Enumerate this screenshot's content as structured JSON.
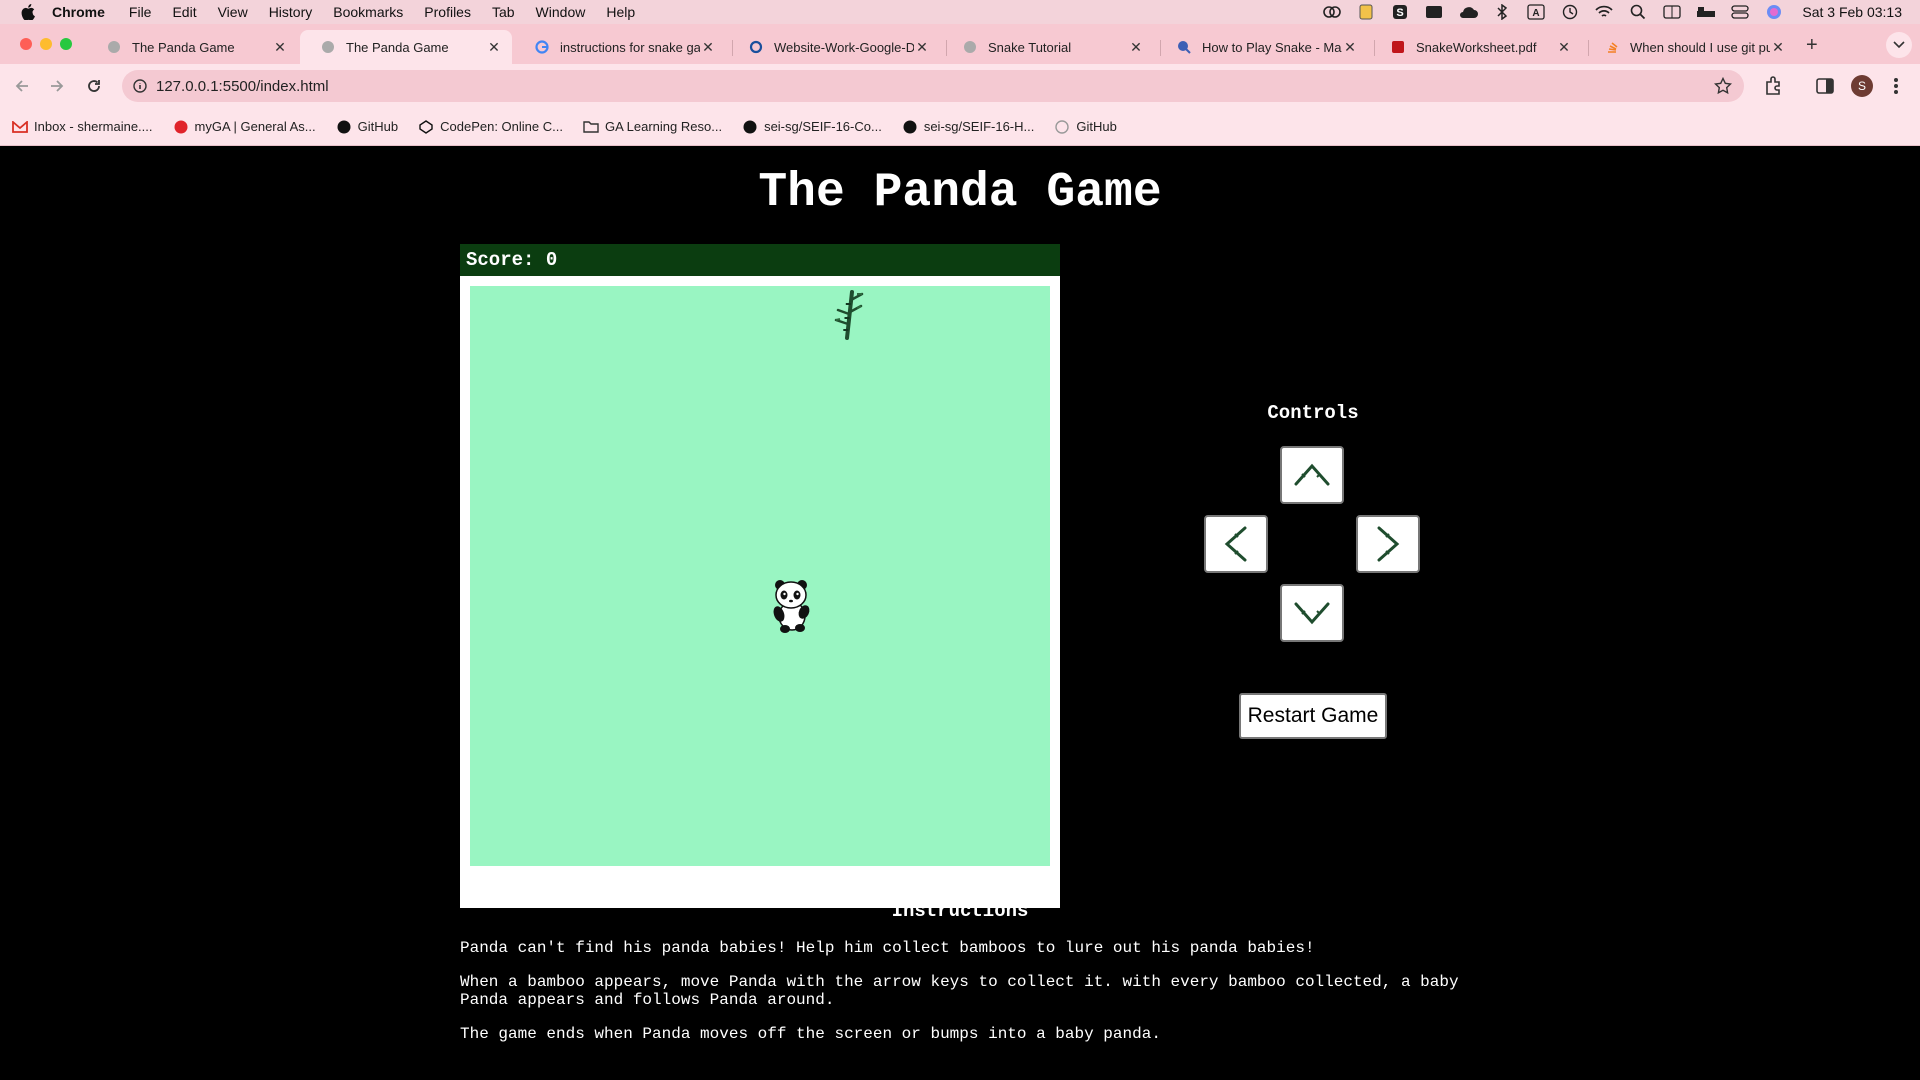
{
  "menubar": {
    "app": "Chrome",
    "items": [
      "File",
      "Edit",
      "View",
      "History",
      "Bookmarks",
      "Profiles",
      "Tab",
      "Window",
      "Help"
    ],
    "clock": "Sat 3 Feb  03:13"
  },
  "tabs": [
    {
      "title": "The Panda Game",
      "active": false
    },
    {
      "title": "The Panda Game",
      "active": true
    },
    {
      "title": "instructions for snake game",
      "active": false
    },
    {
      "title": "Website-Work-Google-Docs",
      "active": false
    },
    {
      "title": "Snake Tutorial",
      "active": false
    },
    {
      "title": "How to Play Snake - Master",
      "active": false
    },
    {
      "title": "SnakeWorksheet.pdf",
      "active": false
    },
    {
      "title": "When should I use git pull",
      "active": false
    }
  ],
  "toolbar": {
    "url": "127.0.0.1:5500/index.html",
    "profile_initial": "S"
  },
  "bookmarks": [
    {
      "label": "Inbox - shermaine....",
      "icon": "gmail-icon"
    },
    {
      "label": "myGA | General As...",
      "icon": "ga-icon"
    },
    {
      "label": "GitHub",
      "icon": "github-icon"
    },
    {
      "label": "CodePen: Online C...",
      "icon": "codepen-icon"
    },
    {
      "label": "GA Learning Reso...",
      "icon": "folder-icon"
    },
    {
      "label": "sei-sg/SEIF-16-Co...",
      "icon": "github-icon"
    },
    {
      "label": "sei-sg/SEIF-16-H...",
      "icon": "github-icon"
    },
    {
      "label": "GitHub",
      "icon": "github-icon"
    }
  ],
  "game": {
    "title": "The Panda Game",
    "score_label": "Score: 0",
    "controls_title": "Controls",
    "restart_label": "Restart Game",
    "instructions_title": "Instructions",
    "instructions": [
      "Panda can't find his panda babies! Help him collect bamboos to lure out his panda babies!",
      "When a bamboo appears, move Panda with the arrow keys to collect it. with every bamboo collected, a baby Panda appears and follows Panda around.",
      "The game ends when Panda moves off the screen or bumps into a baby panda."
    ],
    "board_color": "#99f5c2",
    "scorebar_color": "#0b3d10"
  }
}
